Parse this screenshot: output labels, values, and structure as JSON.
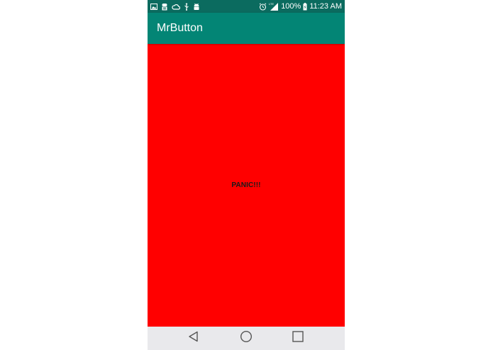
{
  "status_bar": {
    "icons_left": [
      "image-icon",
      "android-debug-icon",
      "cloud-icon",
      "usb-icon",
      "android-icon"
    ],
    "icons_right": [
      "alarm-icon",
      "lte-signal-icon",
      "battery-icon"
    ],
    "lte_label": "LTE",
    "battery": "100%",
    "time": "11:23 AM"
  },
  "app_bar": {
    "title": "MrButton"
  },
  "main": {
    "button_label": "PANIC!!!",
    "button_color": "#ff0000"
  },
  "nav_bar": {
    "buttons": [
      "back",
      "home",
      "recents"
    ]
  },
  "colors": {
    "status_bar": "#0b6b5f",
    "app_bar": "#038575",
    "nav_bar": "#e9e9ec"
  }
}
